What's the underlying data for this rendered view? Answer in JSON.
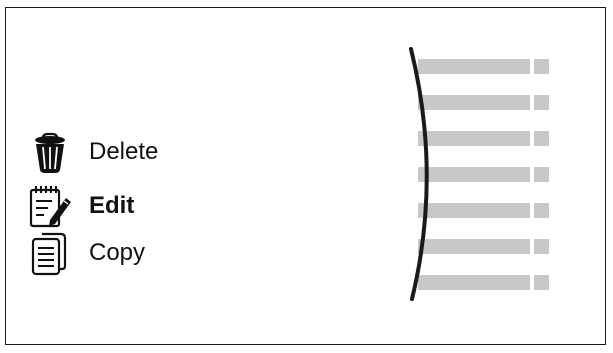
{
  "menu": {
    "items": [
      {
        "label": "Delete",
        "icon": "trash-icon",
        "bold": false
      },
      {
        "label": "Edit",
        "icon": "notepad-pencil-icon",
        "bold": true
      },
      {
        "label": "Copy",
        "icon": "copy-documents-icon",
        "bold": false
      }
    ]
  },
  "list": {
    "row_count": 7,
    "bar_color": "#c8c8c8",
    "curve_color": "#1a1a1a"
  },
  "colors": {
    "text": "#111111",
    "border": "#1a1a1a",
    "background": "#ffffff"
  }
}
